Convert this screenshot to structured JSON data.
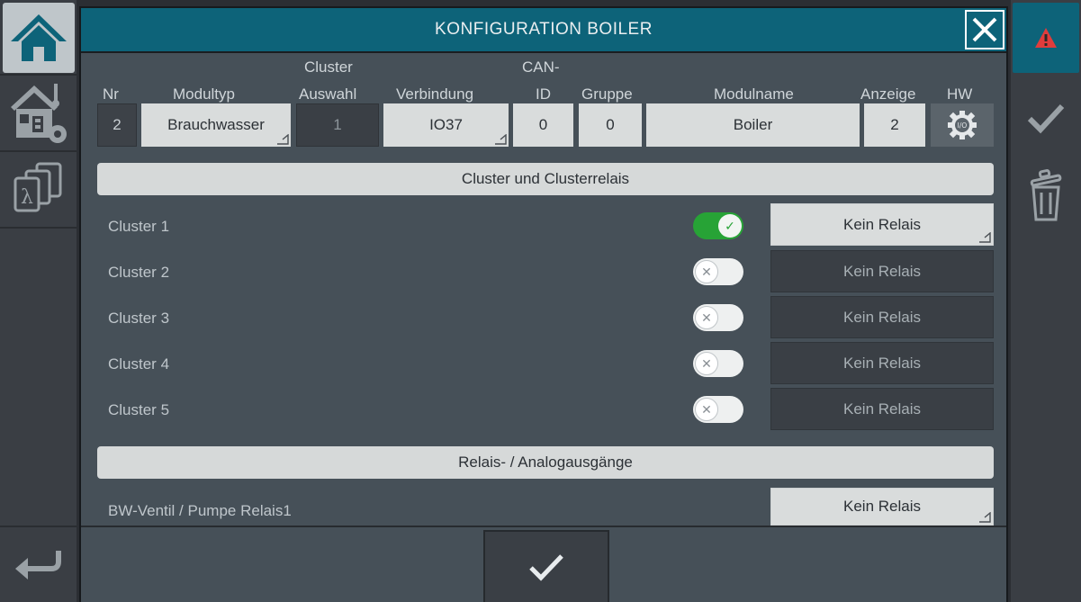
{
  "title": "KONFIGURATION BOILER",
  "left_nav": {
    "home_icon": "home-icon",
    "house_settings_icon": "house-settings-icon",
    "lambda_icon": "lambda-pages-icon",
    "back_icon": "back-arrow-icon"
  },
  "right_nav": {
    "alert_icon": "warning-icon",
    "save_icon": "checkmark-icon",
    "delete_icon": "trash-icon"
  },
  "header": {
    "nr_label": "Nr",
    "modultyp_label": "Modultyp",
    "cluster_label_line1": "Cluster",
    "cluster_label_line2": "Auswahl",
    "verbindung_label": "Verbindung",
    "canid_label_line1": "CAN-",
    "canid_label_line2": "ID",
    "gruppe_label": "Gruppe",
    "modulname_label": "Modulname",
    "anzeige_label": "Anzeige",
    "hw_label": "HW"
  },
  "fields": {
    "nr": "2",
    "modultyp": "Brauchwasser",
    "cluster_auswahl": "1",
    "verbindung": "IO37",
    "can_id": "0",
    "gruppe": "0",
    "modulname": "Boiler",
    "anzeige": "2",
    "hw_icon_text": "I/O"
  },
  "cluster_section": {
    "title": "Cluster und Clusterrelais",
    "rows": [
      {
        "label": "Cluster 1",
        "enabled": true,
        "relay": "Kein Relais"
      },
      {
        "label": "Cluster 2",
        "enabled": false,
        "relay": "Kein Relais"
      },
      {
        "label": "Cluster 3",
        "enabled": false,
        "relay": "Kein Relais"
      },
      {
        "label": "Cluster 4",
        "enabled": false,
        "relay": "Kein Relais"
      },
      {
        "label": "Cluster 5",
        "enabled": false,
        "relay": "Kein Relais"
      }
    ]
  },
  "output_section": {
    "title": "Relais- / Analogausgänge",
    "rows": [
      {
        "label": "BW-Ventil / Pumpe Relais1",
        "relay": "Kein Relais"
      }
    ]
  },
  "toggle_glyphs": {
    "on": "✓",
    "off": "✕"
  },
  "colors": {
    "accent": "#0d6379",
    "toggle_on": "#27a336",
    "dialog_bg": "#465058"
  }
}
